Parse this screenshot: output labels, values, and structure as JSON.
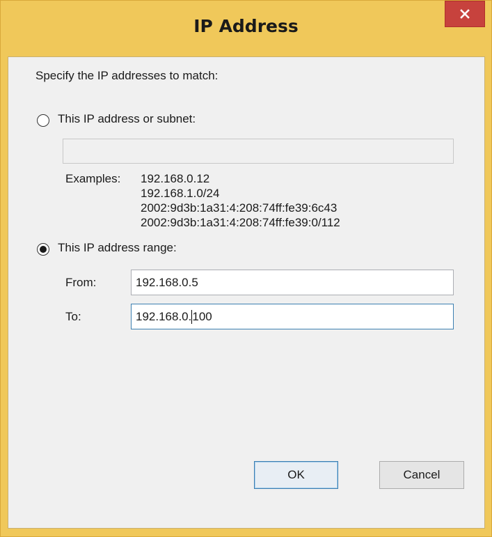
{
  "window": {
    "title": "IP Address",
    "close_label": "close"
  },
  "instruction": "Specify the IP addresses to match:",
  "option_subnet": {
    "label": "This IP address or subnet:",
    "selected": false,
    "value": "",
    "examples_label": "Examples:",
    "examples": [
      "192.168.0.12",
      "192.168.1.0/24",
      "2002:9d3b:1a31:4:208:74ff:fe39:6c43",
      "2002:9d3b:1a31:4:208:74ff:fe39:0/112"
    ]
  },
  "option_range": {
    "label": "This IP address range:",
    "selected": true,
    "from_label": "From:",
    "from_value": "192.168.0.5",
    "to_label": "To:",
    "to_value_before_caret": "192.168.0.",
    "to_value_after_caret": "100"
  },
  "buttons": {
    "ok": "OK",
    "cancel": "Cancel"
  },
  "colors": {
    "title_bar": "#f0c85a",
    "close_button": "#c7423d",
    "focus_border": "#3c7fb1"
  },
  "icons": {
    "close": "close-icon",
    "radio_selected": "radio-selected",
    "radio_unselected": "radio-unselected"
  }
}
